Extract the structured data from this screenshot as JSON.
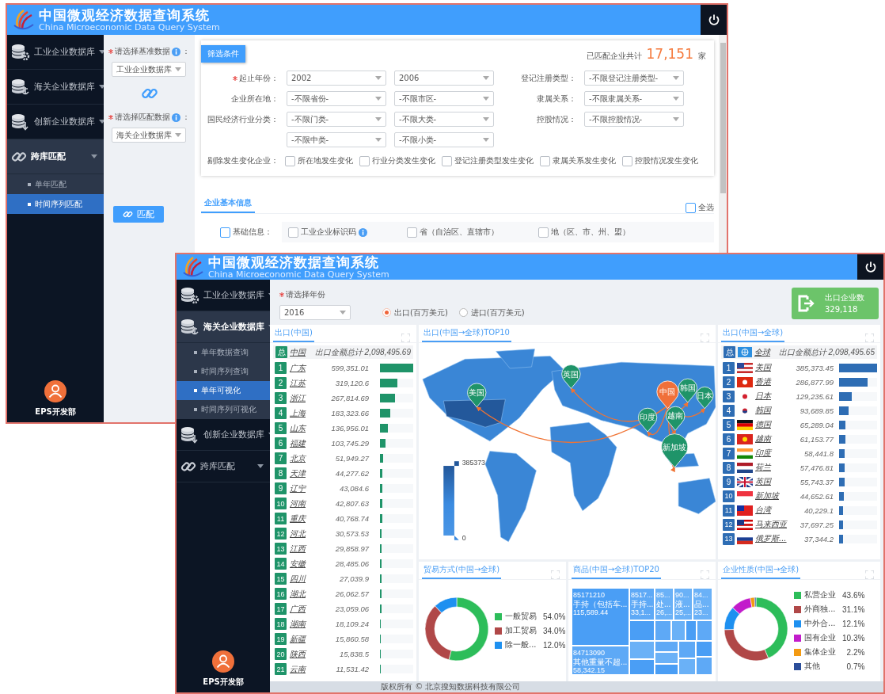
{
  "back_window": {
    "header": {
      "title": "中国微观经济数据查询系统",
      "subtitle": "China Microeconomic Data Query System"
    },
    "sidebar": {
      "items": [
        {
          "kind": "gear",
          "label": "工业企业数据库",
          "expanded": false
        },
        {
          "kind": "anchor",
          "label": "海关企业数据库",
          "expanded": false
        },
        {
          "kind": "arrow",
          "label": "创新企业数据库",
          "expanded": false
        },
        {
          "kind": "link",
          "label": "跨库匹配",
          "expanded": true,
          "children": [
            {
              "label": "单年匹配",
              "selected": false
            },
            {
              "label": "时间序列匹配",
              "selected": true
            }
          ]
        }
      ]
    },
    "user": {
      "name": "EPS开发部"
    },
    "match_panel": {
      "base_label": "请选择基准数据",
      "base_required": true,
      "base_suffix": "：",
      "base_value": "工业企业数据库",
      "target_label": "请选择匹配数据",
      "target_required": true,
      "target_suffix": "：",
      "target_value": "海关企业数据库",
      "button": "匹配"
    },
    "filter": {
      "tab": "筛选条件",
      "summary_label": "已匹配企业共计",
      "summary_count": "17,151",
      "summary_unit": "家",
      "rows": [
        {
          "label": "起止年份：",
          "required": true,
          "selects": [
            "2002",
            "2006"
          ],
          "side_label": "登记注册类型：",
          "side_select": "-不限登记注册类型-"
        },
        {
          "label": "企业所在地：",
          "required": false,
          "selects": [
            "-不限省份-",
            "-不限市区-"
          ],
          "side_label": "隶属关系：",
          "side_select": "-不限隶属关系-"
        },
        {
          "label": "国民经济行业分类：",
          "required": false,
          "selects": [
            "-不限门类-",
            "-不限大类-"
          ],
          "side_label": "控股情况：",
          "side_select": "-不限控股情况-"
        },
        {
          "selects": [
            "-不限中类-",
            "-不限小类-"
          ]
        }
      ],
      "exclude_label": "剔除发生变化企业：",
      "exclude_options": [
        {
          "label": "所在地发生变化",
          "checked": false
        },
        {
          "label": "行业分类发生变化",
          "checked": false
        },
        {
          "label": "登记注册类型发生变化",
          "checked": false
        },
        {
          "label": "隶属关系发生变化",
          "checked": false
        },
        {
          "label": "控股情况发生变化",
          "checked": false
        }
      ]
    },
    "info": {
      "tab": {
        "label": "企业基本信息",
        "selected": true
      },
      "select_all": {
        "label": "全选",
        "checked": false
      },
      "group": {
        "label": "基础信息：",
        "checked": false
      },
      "fields": [
        {
          "label": "工业企业标识码",
          "checked": false,
          "info": true
        },
        {
          "label": "省（自治区、直辖市）",
          "checked": false,
          "info": false
        },
        {
          "label": "地（区、市、州、盟）",
          "checked": false,
          "info": false
        }
      ]
    }
  },
  "front_window": {
    "header": {
      "title": "中国微观经济数据查询系统",
      "subtitle": "China Microeconomic Data Query System"
    },
    "sidebar": {
      "items": [
        {
          "kind": "gear",
          "label": "工业企业数据库",
          "expanded": false
        },
        {
          "kind": "anchor",
          "label": "海关企业数据库",
          "expanded": true,
          "children": [
            {
              "label": "单年数据查询",
              "selected": false
            },
            {
              "label": "时间序列查询",
              "selected": false
            },
            {
              "label": "单年可视化",
              "selected": true
            },
            {
              "label": "时间序列可视化",
              "selected": false
            }
          ]
        },
        {
          "kind": "arrow",
          "label": "创新企业数据库",
          "expanded": false
        },
        {
          "kind": "link",
          "label": "跨库匹配",
          "expanded": false
        }
      ]
    },
    "user": {
      "name": "EPS开发部"
    },
    "year_label": "请选择年份",
    "year_required": true,
    "year_value": "2016",
    "radios": [
      {
        "label": "出口(百万美元)",
        "selected": true
      },
      {
        "label": "进口(百万美元)",
        "selected": false
      }
    ],
    "export_card": {
      "label": "出口企业数",
      "value": "329,118"
    },
    "province_panel": {
      "title": "出口(中国)",
      "total": {
        "badge": "总",
        "name": "中国",
        "label": "出口金额总计 2,098,495.69"
      },
      "rows": [
        {
          "rank": "1",
          "name": "广东",
          "value": "599,351.01",
          "level": 1
        },
        {
          "rank": "2",
          "name": "江苏",
          "value": "319,120.6",
          "level": 0.532
        },
        {
          "rank": "3",
          "name": "浙江",
          "value": "267,814.69",
          "level": 0.447
        },
        {
          "rank": "4",
          "name": "上海",
          "value": "183,323.66",
          "level": 0.306
        },
        {
          "rank": "5",
          "name": "山东",
          "value": "136,956.01",
          "level": 0.229
        },
        {
          "rank": "6",
          "name": "福建",
          "value": "103,745.29",
          "level": 0.173
        },
        {
          "rank": "7",
          "name": "北京",
          "value": "51,949.27",
          "level": 0.087
        },
        {
          "rank": "8",
          "name": "天津",
          "value": "44,277.62",
          "level": 0.074
        },
        {
          "rank": "9",
          "name": "辽宁",
          "value": "43,084.6",
          "level": 0.072
        },
        {
          "rank": "10",
          "name": "河南",
          "value": "42,807.63",
          "level": 0.071
        },
        {
          "rank": "11",
          "name": "重庆",
          "value": "40,768.74",
          "level": 0.068
        },
        {
          "rank": "12",
          "name": "河北",
          "value": "30,573.53",
          "level": 0.051
        },
        {
          "rank": "13",
          "name": "江西",
          "value": "29,858.97",
          "level": 0.05
        },
        {
          "rank": "14",
          "name": "安徽",
          "value": "28,485.06",
          "level": 0.048
        },
        {
          "rank": "15",
          "name": "四川",
          "value": "27,039.9",
          "level": 0.045
        },
        {
          "rank": "16",
          "name": "湖北",
          "value": "26,062.57",
          "level": 0.043
        },
        {
          "rank": "17",
          "name": "广西",
          "value": "23,059.06",
          "level": 0.038
        },
        {
          "rank": "18",
          "name": "湖南",
          "value": "18,109.24",
          "level": 0.03
        },
        {
          "rank": "19",
          "name": "新疆",
          "value": "15,860.58",
          "level": 0.026
        },
        {
          "rank": "20",
          "name": "陕西",
          "value": "15,838.5",
          "level": 0.026
        },
        {
          "rank": "21",
          "name": "云南",
          "value": "11,531.42",
          "level": 0.019
        }
      ]
    },
    "map_panel": {
      "title": "出口(中国→全球)TOP10",
      "legend_max": "385373",
      "legend_min": "0",
      "pins": [
        {
          "label": "美国",
          "kind": "target"
        },
        {
          "label": "英国",
          "kind": "target"
        },
        {
          "label": "中国",
          "kind": "origin"
        },
        {
          "label": "韩国",
          "kind": "target"
        },
        {
          "label": "日本",
          "kind": "target"
        },
        {
          "label": "印度",
          "kind": "target"
        },
        {
          "label": "越南",
          "kind": "target"
        },
        {
          "label": "新加坡",
          "kind": "target"
        }
      ]
    },
    "country_panel": {
      "title": "出口(中国→全球)",
      "total": {
        "badge": "总",
        "name": "全球",
        "label": "出口金额总计 2,098,495.65"
      },
      "rows": [
        {
          "rank": "1",
          "name": "美国",
          "value": "385,373.45",
          "level": 1
        },
        {
          "rank": "2",
          "name": "香港",
          "value": "286,877.99",
          "level": 0.744
        },
        {
          "rank": "3",
          "name": "日本",
          "value": "129,235.61",
          "level": 0.335
        },
        {
          "rank": "4",
          "name": "韩国",
          "value": "93,689.85",
          "level": 0.243
        },
        {
          "rank": "5",
          "name": "德国",
          "value": "65,289.04",
          "level": 0.169
        },
        {
          "rank": "6",
          "name": "越南",
          "value": "61,153.77",
          "level": 0.159
        },
        {
          "rank": "7",
          "name": "印度",
          "value": "58,441.8",
          "level": 0.152
        },
        {
          "rank": "8",
          "name": "荷兰",
          "value": "57,476.81",
          "level": 0.149
        },
        {
          "rank": "9",
          "name": "英国",
          "value": "55,743.37",
          "level": 0.145
        },
        {
          "rank": "10",
          "name": "新加坡",
          "value": "44,652.61",
          "level": 0.116
        },
        {
          "rank": "11",
          "name": "台湾",
          "value": "40,229.1",
          "level": 0.104
        },
        {
          "rank": "12",
          "name": "马来西亚",
          "value": "37,697.25",
          "level": 0.098
        },
        {
          "rank": "13",
          "name": "俄罗斯...",
          "value": "37,344.2",
          "level": 0.097
        }
      ]
    },
    "trade_panel": {
      "title": "贸易方式(中国→全球)",
      "legend": [
        {
          "label": "一般贸易",
          "share": "54.0%",
          "color": "#2dbd5a"
        },
        {
          "label": "加工贸易",
          "share": "34.0%",
          "color": "#b04848"
        },
        {
          "label": "除一般...",
          "share": "12.0%",
          "color": "#1e90f0"
        }
      ],
      "chart_data": {
        "type": "donut",
        "series": [
          {
            "values": [
              54.0,
              34.0,
              12.0
            ]
          }
        ]
      }
    },
    "goods_panel": {
      "title": "商品(中国→全球)TOP20",
      "tiles": [
        {
          "code": "85171210",
          "name": "手持（包括车...",
          "value": "115,589.44"
        },
        {
          "code": "84713090",
          "name": "其他重量不超...",
          "value": "58,342.15"
        },
        {
          "code": "8517...",
          "name": "手持...",
          "value": "33,1..."
        },
        {
          "code": "85...",
          "name": "处...",
          "value": "26,..."
        },
        {
          "code": "90...",
          "name": "液...",
          "value": "25,..."
        },
        {
          "code": "84...",
          "name": "品...",
          "value": "23..."
        }
      ]
    },
    "nature_panel": {
      "title": "企业性质(中国→全球)",
      "legend": [
        {
          "label": "私营企业",
          "share": "43.6%",
          "color": "#2dbd5a"
        },
        {
          "label": "外商独...",
          "share": "31.1%",
          "color": "#b04848"
        },
        {
          "label": "中外合...",
          "share": "12.1%",
          "color": "#1e90f0"
        },
        {
          "label": "国有企业",
          "share": "10.3%",
          "color": "#c21ccb"
        },
        {
          "label": "集体企业",
          "share": "2.2%",
          "color": "#f39a12"
        },
        {
          "label": "其他",
          "share": "0.7%",
          "color": "#2b4e9a"
        }
      ],
      "chart_data": {
        "type": "donut",
        "series": [
          {
            "values": [
              43.6,
              31.1,
              12.1,
              10.3,
              2.2,
              0.7
            ]
          }
        ]
      }
    },
    "footer": "版权所有 © 北京搜知数据科技有限公司"
  }
}
